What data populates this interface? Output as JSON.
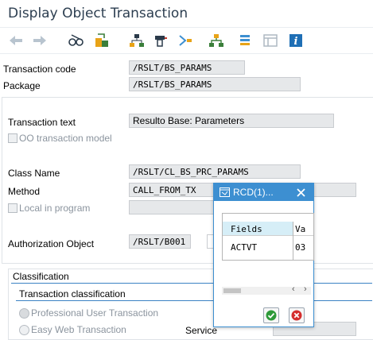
{
  "window": {
    "title": "Display Object Transaction"
  },
  "toolbar": {
    "icons": [
      "back-arrow-icon",
      "forward-arrow-icon",
      "glasses-display-change-icon",
      "object-activation-icon",
      "hierarchy-objects-icon",
      "where-used-icon",
      "navigation-icon",
      "enterprise-structure-icon",
      "stack-icon",
      "layout-icon",
      "info-icon"
    ]
  },
  "header": {
    "transaction_code_label": "Transaction code",
    "transaction_code_value": "/RSLT/BS_PARAMS",
    "package_label": "Package",
    "package_value": "/RSLT/BS_PARAMS"
  },
  "details": {
    "transaction_text_label": "Transaction text",
    "transaction_text_value": "Resulto Base: Parameters",
    "oo_model_label": "OO transaction model",
    "class_name_label": "Class Name",
    "class_name_value": "/RSLT/CL_BS_PRC_PARAMS",
    "method_label": "Method",
    "method_value": "CALL_FROM_TX",
    "local_program_label": "Local in program",
    "auth_object_label": "Authorization Object",
    "auth_object_value": "/RSLT/B001"
  },
  "classification": {
    "section_title": "Classification",
    "subsection_title": "Transaction classification",
    "options": [
      "Professional User Transaction",
      "Easy Web Transaction"
    ],
    "service_label": "Service"
  },
  "popup": {
    "title": "RCD(1)...",
    "columns": [
      "Fields",
      "Va"
    ],
    "rows": [
      {
        "field": "ACTVT",
        "value": "03"
      }
    ]
  },
  "colors": {
    "accent": "#3d8fd1",
    "title": "#2c3e50",
    "field_bg": "#e6e8ea"
  }
}
